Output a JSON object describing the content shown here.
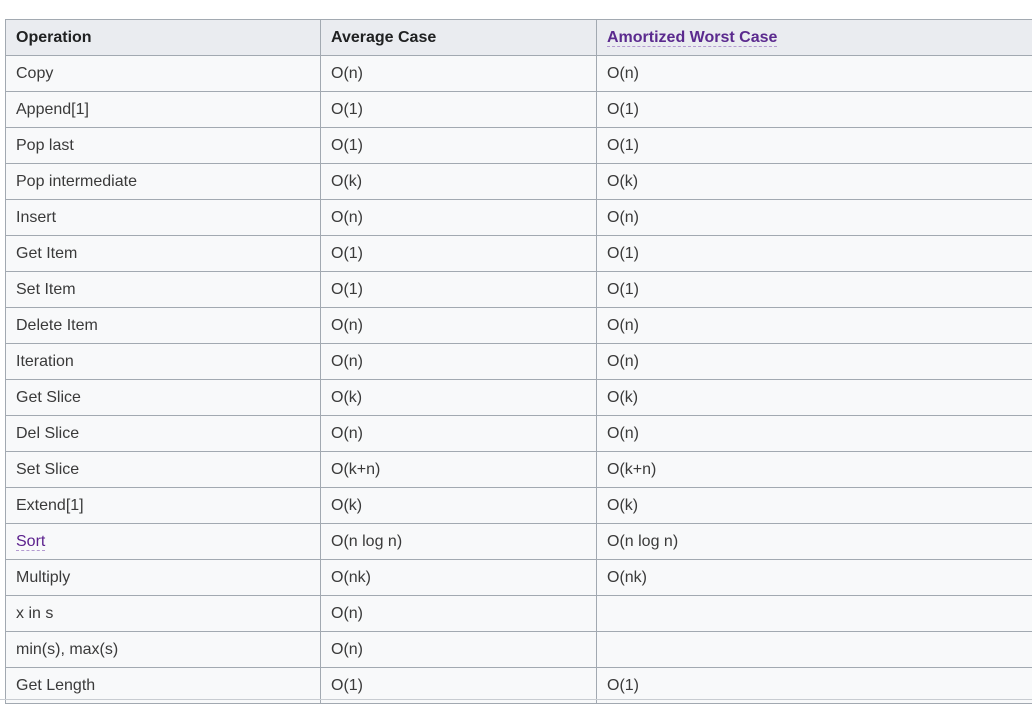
{
  "table": {
    "headers": [
      "Operation",
      "Average Case",
      "Amortized Worst Case"
    ],
    "rows": [
      {
        "op": "Copy",
        "avg": "O(n)",
        "worst": "O(n)"
      },
      {
        "op": "Append[1]",
        "avg": "O(1)",
        "worst": "O(1)"
      },
      {
        "op": "Pop last",
        "avg": "O(1)",
        "worst": "O(1)"
      },
      {
        "op": "Pop intermediate",
        "avg": "O(k)",
        "worst": "O(k)"
      },
      {
        "op": "Insert",
        "avg": "O(n)",
        "worst": "O(n)"
      },
      {
        "op": "Get Item",
        "avg": "O(1)",
        "worst": "O(1)"
      },
      {
        "op": "Set Item",
        "avg": "O(1)",
        "worst": "O(1)"
      },
      {
        "op": "Delete Item",
        "avg": "O(n)",
        "worst": "O(n)"
      },
      {
        "op": "Iteration",
        "avg": "O(n)",
        "worst": "O(n)"
      },
      {
        "op": "Get Slice",
        "avg": "O(k)",
        "worst": "O(k)"
      },
      {
        "op": "Del Slice",
        "avg": "O(n)",
        "worst": "O(n)"
      },
      {
        "op": "Set Slice",
        "avg": "O(k+n)",
        "worst": "O(k+n)"
      },
      {
        "op": "Extend[1]",
        "avg": "O(k)",
        "worst": "O(k)"
      },
      {
        "op": "Sort",
        "avg": "O(n log n)",
        "worst": "O(n log n)"
      },
      {
        "op": "Multiply",
        "avg": "O(nk)",
        "worst": "O(nk)"
      },
      {
        "op": "x in s",
        "avg": "O(n)",
        "worst": ""
      },
      {
        "op": "min(s), max(s)",
        "avg": "O(n)",
        "worst": ""
      },
      {
        "op": "Get Length",
        "avg": "O(1)",
        "worst": "O(1)"
      }
    ]
  },
  "colors": {
    "header_bg": "#eaecf0",
    "cell_bg": "#f8f9fa",
    "border": "#a2a9b1",
    "link": "#5a1f8c"
  }
}
